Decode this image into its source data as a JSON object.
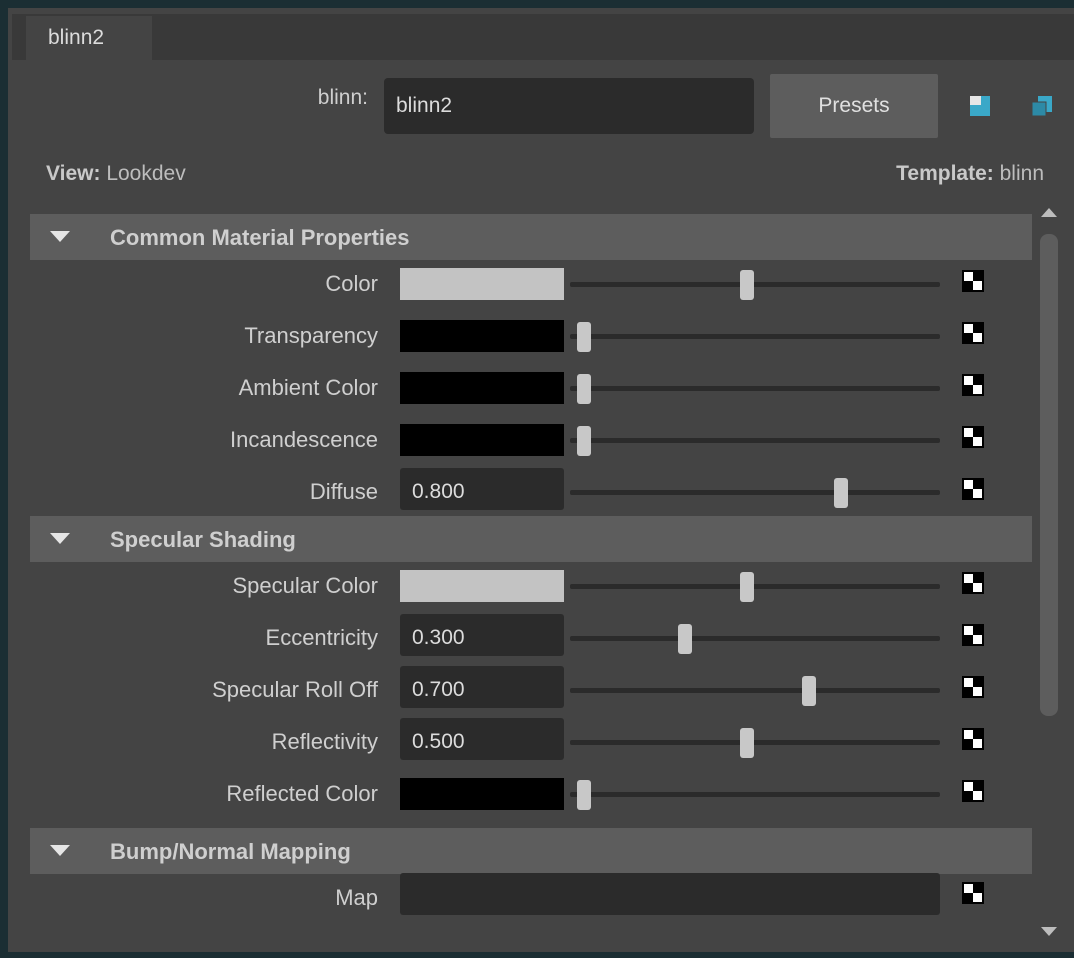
{
  "tab": {
    "label": "blinn2"
  },
  "node": {
    "type_label": "blinn:",
    "name_value": "blinn2"
  },
  "presets_label": "Presets",
  "view": {
    "prefix": "View:",
    "value": "Lookdev"
  },
  "template": {
    "prefix": "Template:",
    "value": "blinn"
  },
  "sections": [
    {
      "title": "Common Material Properties",
      "attrs": [
        {
          "label": "Color",
          "kind": "color",
          "swatch": "#c3c3c3",
          "slider": 0.5
        },
        {
          "label": "Transparency",
          "kind": "color",
          "swatch": "#000000",
          "slider": 0.0
        },
        {
          "label": "Ambient Color",
          "kind": "color",
          "swatch": "#000000",
          "slider": 0.0
        },
        {
          "label": "Incandescence",
          "kind": "color",
          "swatch": "#000000",
          "slider": 0.0
        },
        {
          "label": "Diffuse",
          "kind": "number",
          "value": "0.800",
          "slider": 0.8
        }
      ]
    },
    {
      "title": "Specular Shading",
      "attrs": [
        {
          "label": "Specular Color",
          "kind": "color",
          "swatch": "#c3c3c3",
          "slider": 0.5
        },
        {
          "label": "Eccentricity",
          "kind": "number",
          "value": "0.300",
          "slider": 0.3
        },
        {
          "label": "Specular Roll Off",
          "kind": "number",
          "value": "0.700",
          "slider": 0.7
        },
        {
          "label": "Reflectivity",
          "kind": "number",
          "value": "0.500",
          "slider": 0.5
        },
        {
          "label": "Reflected Color",
          "kind": "color",
          "swatch": "#000000",
          "slider": 0.0
        }
      ]
    },
    {
      "title": "Bump/Normal Mapping",
      "attrs": [
        {
          "label": "Map",
          "kind": "map"
        }
      ]
    }
  ],
  "colors": {
    "accent_icon": "#3aa8c8",
    "panel": "#444444",
    "header": "#5d5d5d"
  }
}
